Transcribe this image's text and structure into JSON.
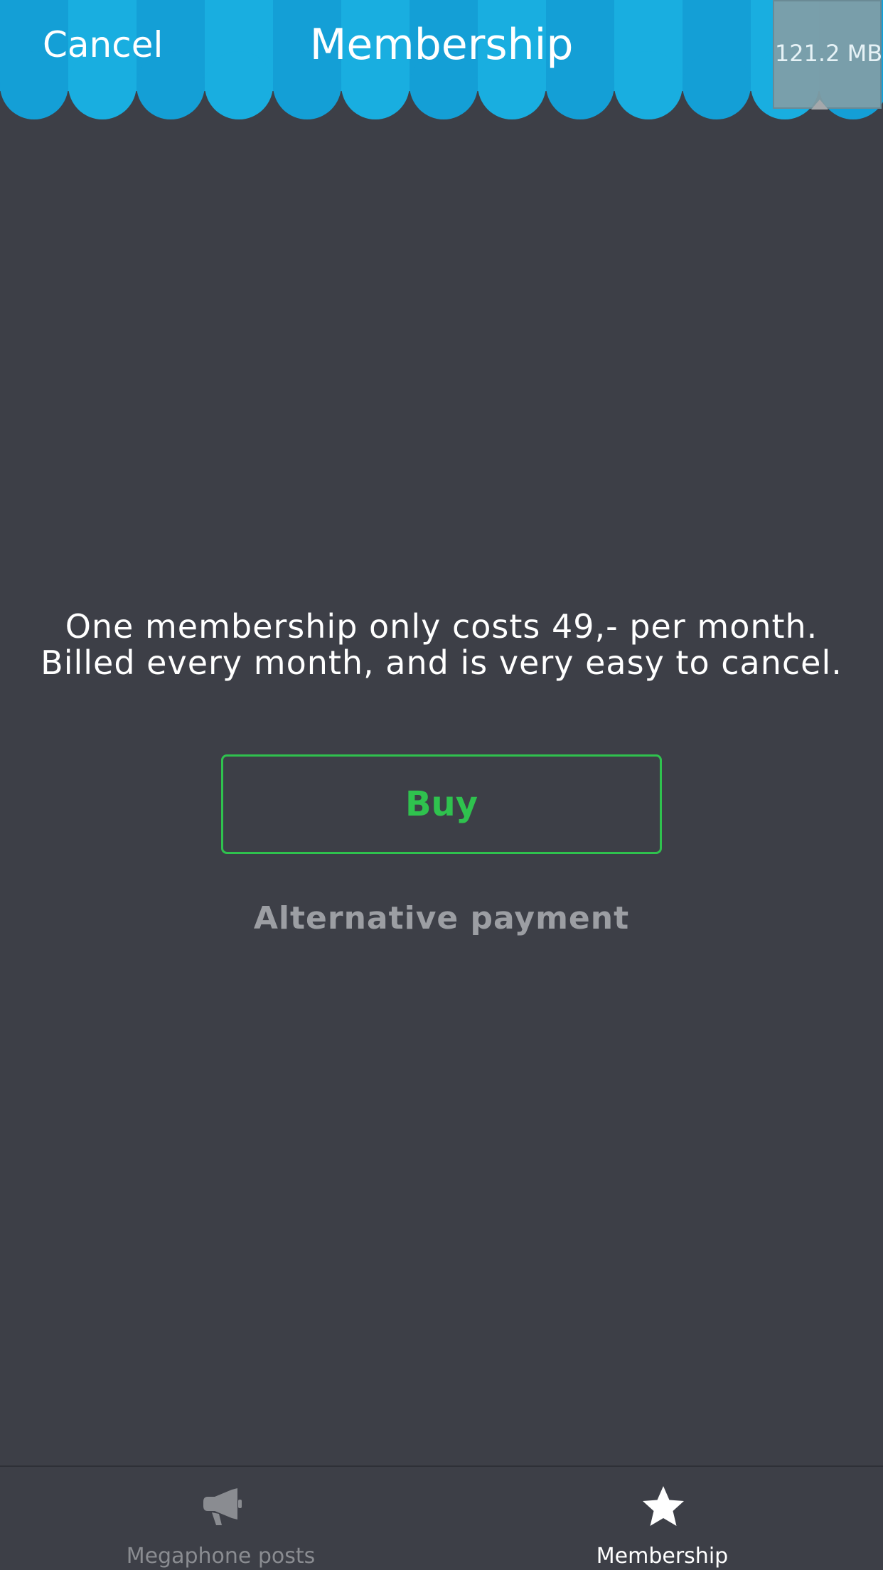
{
  "header": {
    "cancel_label": "Cancel",
    "title": "Membership",
    "memory_badge": "121.2 MB"
  },
  "main": {
    "description": "One membership only costs 49,- per month. Billed every month, and is very easy to cancel.",
    "buy_label": "Buy",
    "alternative_payment_label": "Alternative payment"
  },
  "tabbar": {
    "tabs": [
      {
        "label": "Megaphone posts",
        "icon": "megaphone-icon",
        "active": false
      },
      {
        "label": "Membership",
        "icon": "star-icon",
        "active": true
      }
    ]
  },
  "colors": {
    "awning_light": "#19aee0",
    "awning_dark": "#149fd6",
    "background": "#3d3f47",
    "accent_green": "#2fc24e",
    "muted_text": "#9c9ea3"
  }
}
